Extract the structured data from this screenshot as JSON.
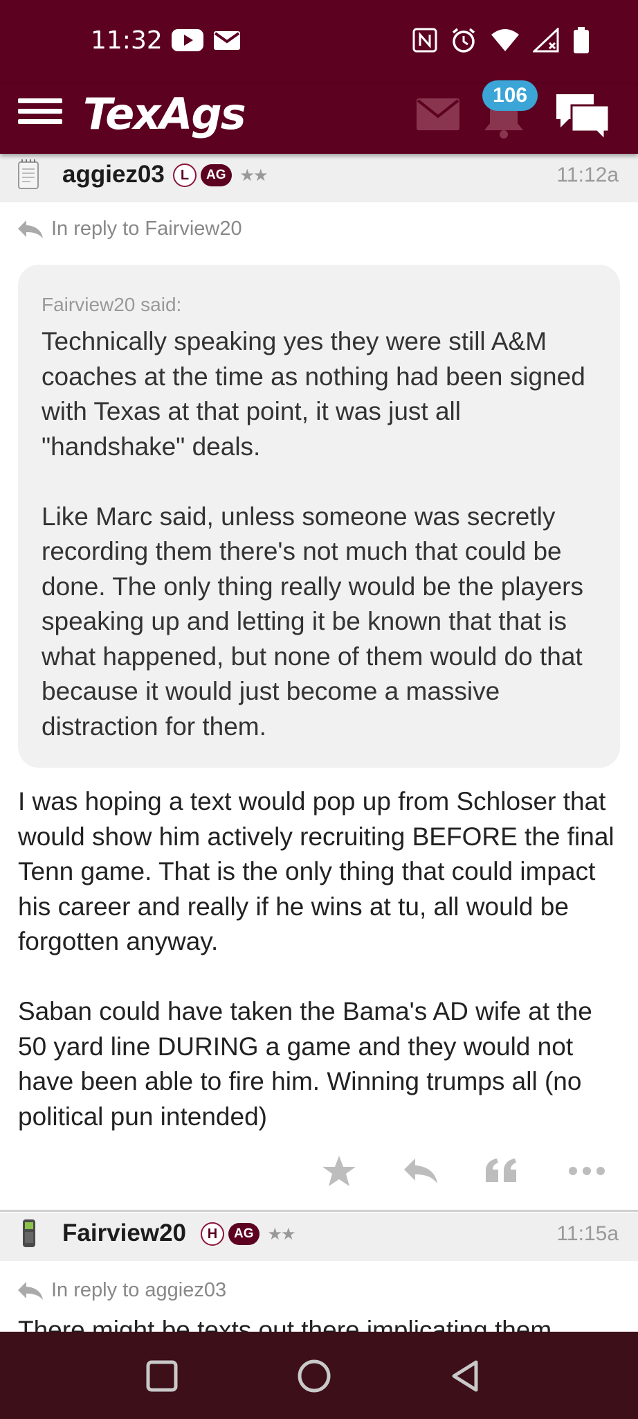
{
  "status_bar": {
    "time": "11:32",
    "left_icons": [
      "youtube-icon",
      "gmail-icon"
    ],
    "right_icons": [
      "nfc-icon",
      "alarm-icon",
      "wifi-icon",
      "signal-icon",
      "battery-icon"
    ]
  },
  "app_bar": {
    "logo": "TexAgs",
    "notification_count": "106",
    "icons": [
      "menu-icon",
      "mail-icon",
      "bell-icon",
      "chat-icon"
    ]
  },
  "posts": [
    {
      "username": "aggiez03",
      "badge_letter": "L",
      "badge_ag": "AG",
      "stars": "★★",
      "time": "11:12a",
      "reply_to": "In reply to Fairview20",
      "quote": {
        "said": "Fairview20 said:",
        "text": "Technically speaking yes they were still A&M coaches at the time as nothing had been signed with Texas at that point, it was just all \"handshake\" deals.\n\nLike Marc said, unless someone was secretly recording them there's not much that could be done. The only thing really would be the players speaking up and letting it be known that that is what happened, but none of them would do that because it would just become a massive distraction for them."
      },
      "body": "I was hoping a text would pop up from Schloser that would show him actively recruiting BEFORE the final Tenn game. That is the only thing that could impact his career and really if he wins at tu, all would be forgotten anyway.\n\nSaban could have taken the Bama's AD wife at the 50 yard line DURING a game and they would not have been able to fire him. Winning trumps all (no political pun intended)",
      "actions": [
        "star-icon",
        "reply-icon",
        "quote-icon",
        "more-icon"
      ]
    },
    {
      "username": "Fairview20",
      "badge_letter": "H",
      "badge_ag": "AG",
      "stars": "★★",
      "time": "11:15a",
      "reply_to": "In reply to aggiez03",
      "body_preview": "There might be texts out there implicating them"
    }
  ],
  "nav_bar": {
    "icons": [
      "recents-icon",
      "home-icon",
      "back-icon"
    ]
  },
  "colors": {
    "maroon": "#5c0120",
    "badge_blue": "#3aa5d6",
    "nav_bg": "#3c0f19"
  }
}
